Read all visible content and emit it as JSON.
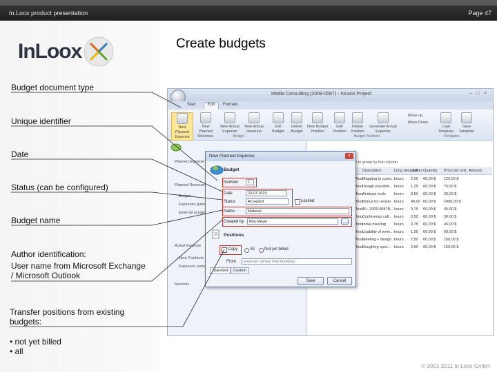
{
  "header": {
    "left": "In.Loox product presentation",
    "right": "Page 47"
  },
  "logo": {
    "text": "InLoox"
  },
  "slide": {
    "title": "Create budgets"
  },
  "labels": {
    "doc_type": "Budget document type",
    "unique_id": "Unique identifier",
    "date": "Date",
    "status": "Status (can be configured)",
    "budget_name": "Budget name",
    "author_1": "Author identification:",
    "author_2": "User name from Microsoft Exchange",
    "author_3": "/ Microsoft Outlook",
    "transfer_1": "Transfer positions from existing",
    "transfer_2": "budgets:",
    "bullet_1": "• not yet billed",
    "bullet_2": "• all"
  },
  "footer": "© 2001-2011 In.Loox GmbH",
  "app": {
    "window_title": "Media Consulting (2009-0087) - InLoox Project",
    "tabs": [
      "Start",
      "Edit",
      "Formats"
    ],
    "selected_tab": "Edit",
    "ribbon": [
      {
        "l1": "New Planned",
        "l2": "Expense"
      },
      {
        "l1": "New Planned",
        "l2": "Revenue"
      },
      {
        "l1": "New Actual",
        "l2": "Expense"
      },
      {
        "l1": "New Actual",
        "l2": "Revenue"
      },
      {
        "l1": "Edit",
        "l2": "Budget"
      },
      {
        "l1": "Delete",
        "l2": "Budget"
      },
      {
        "l1": "New Budget",
        "l2": "Position"
      },
      {
        "l1": "Edit",
        "l2": "Position"
      },
      {
        "l1": "Delete",
        "l2": "Position"
      },
      {
        "l1": "Generate Actual",
        "l2": "Expense"
      },
      {
        "l1": "Load",
        "l2": "Template"
      },
      {
        "l1": "Save",
        "l2": "Template"
      }
    ],
    "ribbon_side": [
      "Move up",
      "Move Down"
    ],
    "groups": {
      "budget": "Budget",
      "positions": "Budget Positions",
      "templates": "Templates"
    },
    "nav": [
      "Planned Expense",
      "Planned Revenue",
      "Budget",
      "Expenses (planned)",
      "External actuals",
      "Actual Expense",
      "Hour Positions",
      "Expenses (actual)",
      "Services"
    ],
    "grid_hint": "...mn to group by that column",
    "grid_headers": [
      "Description",
      "Long description",
      "Unit",
      "Quantity",
      "Price per unit",
      "Amount"
    ],
    "grid_rows": [
      [
        "Mess.",
        "Mapping to custo...",
        "hours",
        "2,00",
        "60,00 $",
        "120,00 $"
      ],
      [
        "Mess.",
        "Design possible...",
        "hours",
        "1,25",
        "60,00 $",
        "75,00 $"
      ],
      [
        "Mess.",
        "Analysis tools",
        "hours",
        "0,50",
        "60,00 $",
        "30,00 $"
      ],
      [
        "Mess.",
        "Bonus for revisio",
        "hours",
        "40,00",
        "60,00 $",
        "2400,00 $"
      ],
      [
        "Mess.",
        "Til : 2009-0087B...",
        "hours",
        "0,75",
        "60,00 $",
        "45,00 $"
      ],
      [
        "Mess.",
        "Conference call...",
        "hours",
        "0,50",
        "60,00 $",
        "30,00 $"
      ],
      [
        "Mess.",
        "Initial meeting",
        "hours",
        "0,75",
        "60,00 $",
        "45,00 $"
      ],
      [
        "Mess.",
        "Usability of even...",
        "hours",
        "1,00",
        "60,00 $",
        "60,00 $"
      ],
      [
        "Mess.",
        "Meeting + design",
        "hours",
        "2,50",
        "60,00 $",
        "150,00 $"
      ],
      [
        "Mess.",
        "Roughing spec...",
        "hours",
        "2,50",
        "60,00 $",
        "150,00 $"
      ]
    ],
    "dialog": {
      "title": "New Planned Expense",
      "section_budget": "Budget",
      "number_label": "Number",
      "number_value": "1",
      "date_label": "Date",
      "date_value": "23.07.2010",
      "status_label": "Status",
      "status_value": "Accepted",
      "locked_label": "Locked",
      "name_label": "Name",
      "name_value": "Material",
      "created_label": "Created by",
      "created_value": "Rita Meyer",
      "section_positions": "Positions",
      "copy_label": "Copy",
      "all_label": "All",
      "not_billed_label": "Not yet billed",
      "from_label": "From",
      "from_value": "Expense (actual time booking)",
      "standard_tab": "Standard",
      "custom_tab": "Custom",
      "save_label": "Save",
      "cancel_label": "Cancel"
    }
  }
}
